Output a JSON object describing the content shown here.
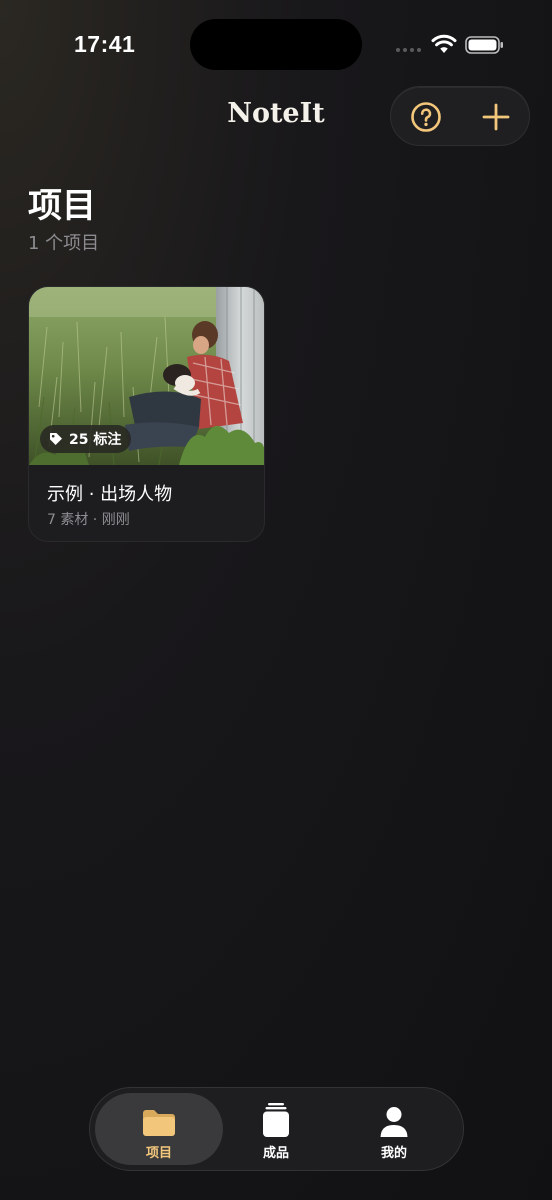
{
  "status_bar": {
    "time": "17:41"
  },
  "header": {
    "app_title": "NoteIt"
  },
  "page": {
    "title": "项目",
    "subtitle": "1 个项目"
  },
  "projects": [
    {
      "title": "示例 · 出场人物",
      "meta": "7 素材 · 刚刚",
      "tag_count_label": "25 标注"
    }
  ],
  "tabbar": {
    "items": [
      {
        "label": "项目",
        "icon": "folder-icon",
        "active": true
      },
      {
        "label": "成品",
        "icon": "stack-icon",
        "active": false
      },
      {
        "label": "我的",
        "icon": "person-icon",
        "active": false
      }
    ]
  },
  "colors": {
    "accent": "#F3C77B",
    "background": "#121214",
    "card": "#1D1D20"
  }
}
